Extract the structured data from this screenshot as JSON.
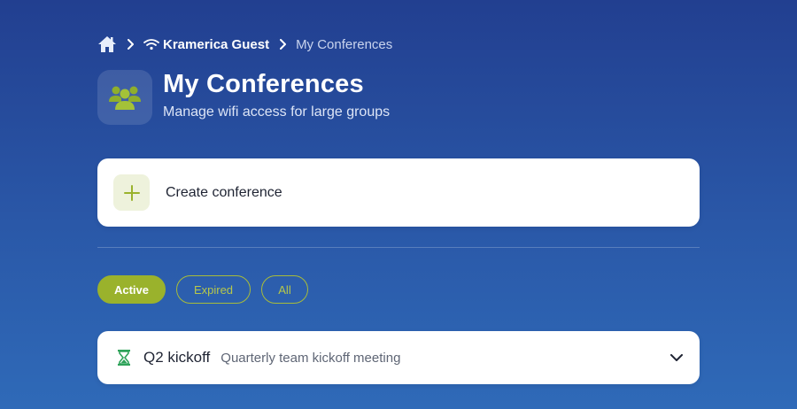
{
  "breadcrumb": {
    "home_icon": "home-icon",
    "network_icon": "wifi-icon",
    "network_label": "Kramerica Guest",
    "current_label": "My Conferences"
  },
  "header": {
    "icon": "users-group-icon",
    "title": "My Conferences",
    "subtitle": "Manage wifi access for large groups"
  },
  "create_card": {
    "icon": "plus-icon",
    "label": "Create conference"
  },
  "filters": [
    {
      "label": "Active",
      "selected": true
    },
    {
      "label": "Expired",
      "selected": false
    },
    {
      "label": "All",
      "selected": false
    }
  ],
  "conferences": [
    {
      "status_icon": "hourglass-icon",
      "name": "Q2 kickoff",
      "description": "Quarterly team kickoff meeting",
      "expand_icon": "chevron-down-icon"
    }
  ],
  "colors": {
    "accent": "#9ab22c",
    "accent_soft": "#eef2dc",
    "status_green": "#2fa35a",
    "background_top": "#223f90",
    "background_bottom": "#2f6ab8"
  }
}
